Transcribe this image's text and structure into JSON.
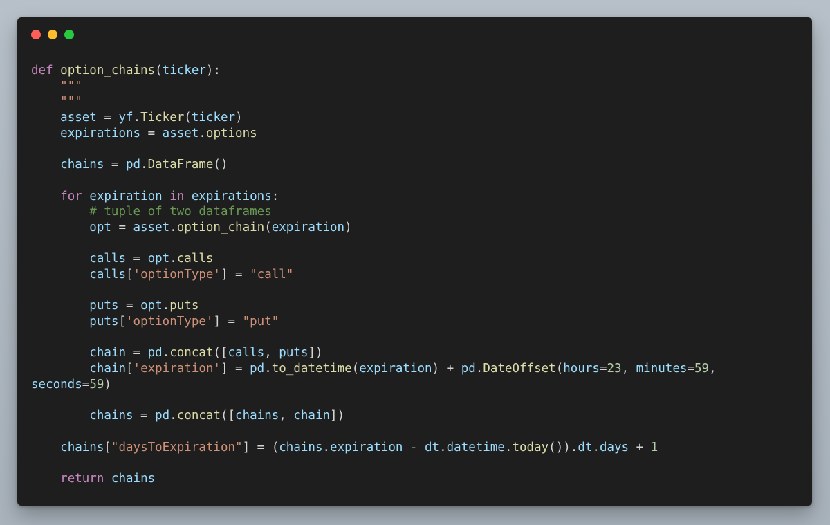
{
  "window": {
    "controls": [
      "close",
      "minimize",
      "maximize"
    ],
    "colors": {
      "background": "#1e1e1e",
      "close": "#ff5f56",
      "minimize": "#ffbd2e",
      "maximize": "#27c93f"
    }
  },
  "code": {
    "language": "python",
    "lines": [
      [
        {
          "t": "def",
          "c": "kw-def"
        },
        {
          "t": " "
        },
        {
          "t": "option_chains",
          "c": "fn"
        },
        {
          "t": "("
        },
        {
          "t": "ticker",
          "c": "var"
        },
        {
          "t": "):"
        }
      ],
      [
        {
          "t": "    "
        },
        {
          "t": "\"\"\"",
          "c": "str"
        }
      ],
      [
        {
          "t": "    "
        },
        {
          "t": "\"\"\"",
          "c": "str"
        }
      ],
      [
        {
          "t": "    "
        },
        {
          "t": "asset",
          "c": "var"
        },
        {
          "t": " = "
        },
        {
          "t": "yf",
          "c": "var"
        },
        {
          "t": "."
        },
        {
          "t": "Ticker",
          "c": "fn"
        },
        {
          "t": "("
        },
        {
          "t": "ticker",
          "c": "var"
        },
        {
          "t": ")"
        }
      ],
      [
        {
          "t": "    "
        },
        {
          "t": "expirations",
          "c": "var"
        },
        {
          "t": " = "
        },
        {
          "t": "asset",
          "c": "var"
        },
        {
          "t": "."
        },
        {
          "t": "options",
          "c": "fn"
        }
      ],
      [
        {
          "t": ""
        }
      ],
      [
        {
          "t": "    "
        },
        {
          "t": "chains",
          "c": "var"
        },
        {
          "t": " = "
        },
        {
          "t": "pd",
          "c": "var"
        },
        {
          "t": "."
        },
        {
          "t": "DataFrame",
          "c": "fn"
        },
        {
          "t": "()"
        }
      ],
      [
        {
          "t": ""
        }
      ],
      [
        {
          "t": "    "
        },
        {
          "t": "for",
          "c": "kw"
        },
        {
          "t": " "
        },
        {
          "t": "expiration",
          "c": "var"
        },
        {
          "t": " "
        },
        {
          "t": "in",
          "c": "kw"
        },
        {
          "t": " "
        },
        {
          "t": "expirations",
          "c": "var"
        },
        {
          "t": ":"
        }
      ],
      [
        {
          "t": "        "
        },
        {
          "t": "# tuple of two dataframes",
          "c": "cmt"
        }
      ],
      [
        {
          "t": "        "
        },
        {
          "t": "opt",
          "c": "var"
        },
        {
          "t": " = "
        },
        {
          "t": "asset",
          "c": "var"
        },
        {
          "t": "."
        },
        {
          "t": "option_chain",
          "c": "fn"
        },
        {
          "t": "("
        },
        {
          "t": "expiration",
          "c": "var"
        },
        {
          "t": ")"
        }
      ],
      [
        {
          "t": ""
        }
      ],
      [
        {
          "t": "        "
        },
        {
          "t": "calls",
          "c": "var"
        },
        {
          "t": " = "
        },
        {
          "t": "opt",
          "c": "var"
        },
        {
          "t": "."
        },
        {
          "t": "calls",
          "c": "fn"
        }
      ],
      [
        {
          "t": "        "
        },
        {
          "t": "calls",
          "c": "var"
        },
        {
          "t": "["
        },
        {
          "t": "'optionType'",
          "c": "str"
        },
        {
          "t": "] = "
        },
        {
          "t": "\"call\"",
          "c": "str"
        }
      ],
      [
        {
          "t": ""
        }
      ],
      [
        {
          "t": "        "
        },
        {
          "t": "puts",
          "c": "var"
        },
        {
          "t": " = "
        },
        {
          "t": "opt",
          "c": "var"
        },
        {
          "t": "."
        },
        {
          "t": "puts",
          "c": "fn"
        }
      ],
      [
        {
          "t": "        "
        },
        {
          "t": "puts",
          "c": "var"
        },
        {
          "t": "["
        },
        {
          "t": "'optionType'",
          "c": "str"
        },
        {
          "t": "] = "
        },
        {
          "t": "\"put\"",
          "c": "str"
        }
      ],
      [
        {
          "t": ""
        }
      ],
      [
        {
          "t": "        "
        },
        {
          "t": "chain",
          "c": "var"
        },
        {
          "t": " = "
        },
        {
          "t": "pd",
          "c": "var"
        },
        {
          "t": "."
        },
        {
          "t": "concat",
          "c": "fn"
        },
        {
          "t": "(["
        },
        {
          "t": "calls",
          "c": "var"
        },
        {
          "t": ", "
        },
        {
          "t": "puts",
          "c": "var"
        },
        {
          "t": "])"
        }
      ],
      [
        {
          "t": "        "
        },
        {
          "t": "chain",
          "c": "var"
        },
        {
          "t": "["
        },
        {
          "t": "'expiration'",
          "c": "str"
        },
        {
          "t": "] = "
        },
        {
          "t": "pd",
          "c": "var"
        },
        {
          "t": "."
        },
        {
          "t": "to_datetime",
          "c": "fn"
        },
        {
          "t": "("
        },
        {
          "t": "expiration",
          "c": "var"
        },
        {
          "t": ") + "
        },
        {
          "t": "pd",
          "c": "var"
        },
        {
          "t": "."
        },
        {
          "t": "DateOffset",
          "c": "fn"
        },
        {
          "t": "("
        },
        {
          "t": "hours",
          "c": "var"
        },
        {
          "t": "="
        },
        {
          "t": "23",
          "c": "num"
        },
        {
          "t": ", "
        },
        {
          "t": "minutes",
          "c": "var"
        },
        {
          "t": "="
        },
        {
          "t": "59",
          "c": "num"
        },
        {
          "t": ","
        }
      ],
      [
        {
          "t": "seconds",
          "c": "var"
        },
        {
          "t": "="
        },
        {
          "t": "59",
          "c": "num"
        },
        {
          "t": ")"
        }
      ],
      [
        {
          "t": ""
        }
      ],
      [
        {
          "t": "        "
        },
        {
          "t": "chains",
          "c": "var"
        },
        {
          "t": " = "
        },
        {
          "t": "pd",
          "c": "var"
        },
        {
          "t": "."
        },
        {
          "t": "concat",
          "c": "fn"
        },
        {
          "t": "(["
        },
        {
          "t": "chains",
          "c": "var"
        },
        {
          "t": ", "
        },
        {
          "t": "chain",
          "c": "var"
        },
        {
          "t": "])"
        }
      ],
      [
        {
          "t": ""
        }
      ],
      [
        {
          "t": "    "
        },
        {
          "t": "chains",
          "c": "var"
        },
        {
          "t": "["
        },
        {
          "t": "\"daysToExpiration\"",
          "c": "str"
        },
        {
          "t": "] = ("
        },
        {
          "t": "chains",
          "c": "var"
        },
        {
          "t": "."
        },
        {
          "t": "expiration",
          "c": "var"
        },
        {
          "t": " - "
        },
        {
          "t": "dt",
          "c": "var"
        },
        {
          "t": "."
        },
        {
          "t": "datetime",
          "c": "var"
        },
        {
          "t": "."
        },
        {
          "t": "today",
          "c": "fn"
        },
        {
          "t": "())."
        },
        {
          "t": "dt",
          "c": "var"
        },
        {
          "t": "."
        },
        {
          "t": "days",
          "c": "var"
        },
        {
          "t": " + "
        },
        {
          "t": "1",
          "c": "num"
        }
      ],
      [
        {
          "t": ""
        }
      ],
      [
        {
          "t": "    "
        },
        {
          "t": "return",
          "c": "kw"
        },
        {
          "t": " "
        },
        {
          "t": "chains",
          "c": "var"
        }
      ]
    ]
  }
}
